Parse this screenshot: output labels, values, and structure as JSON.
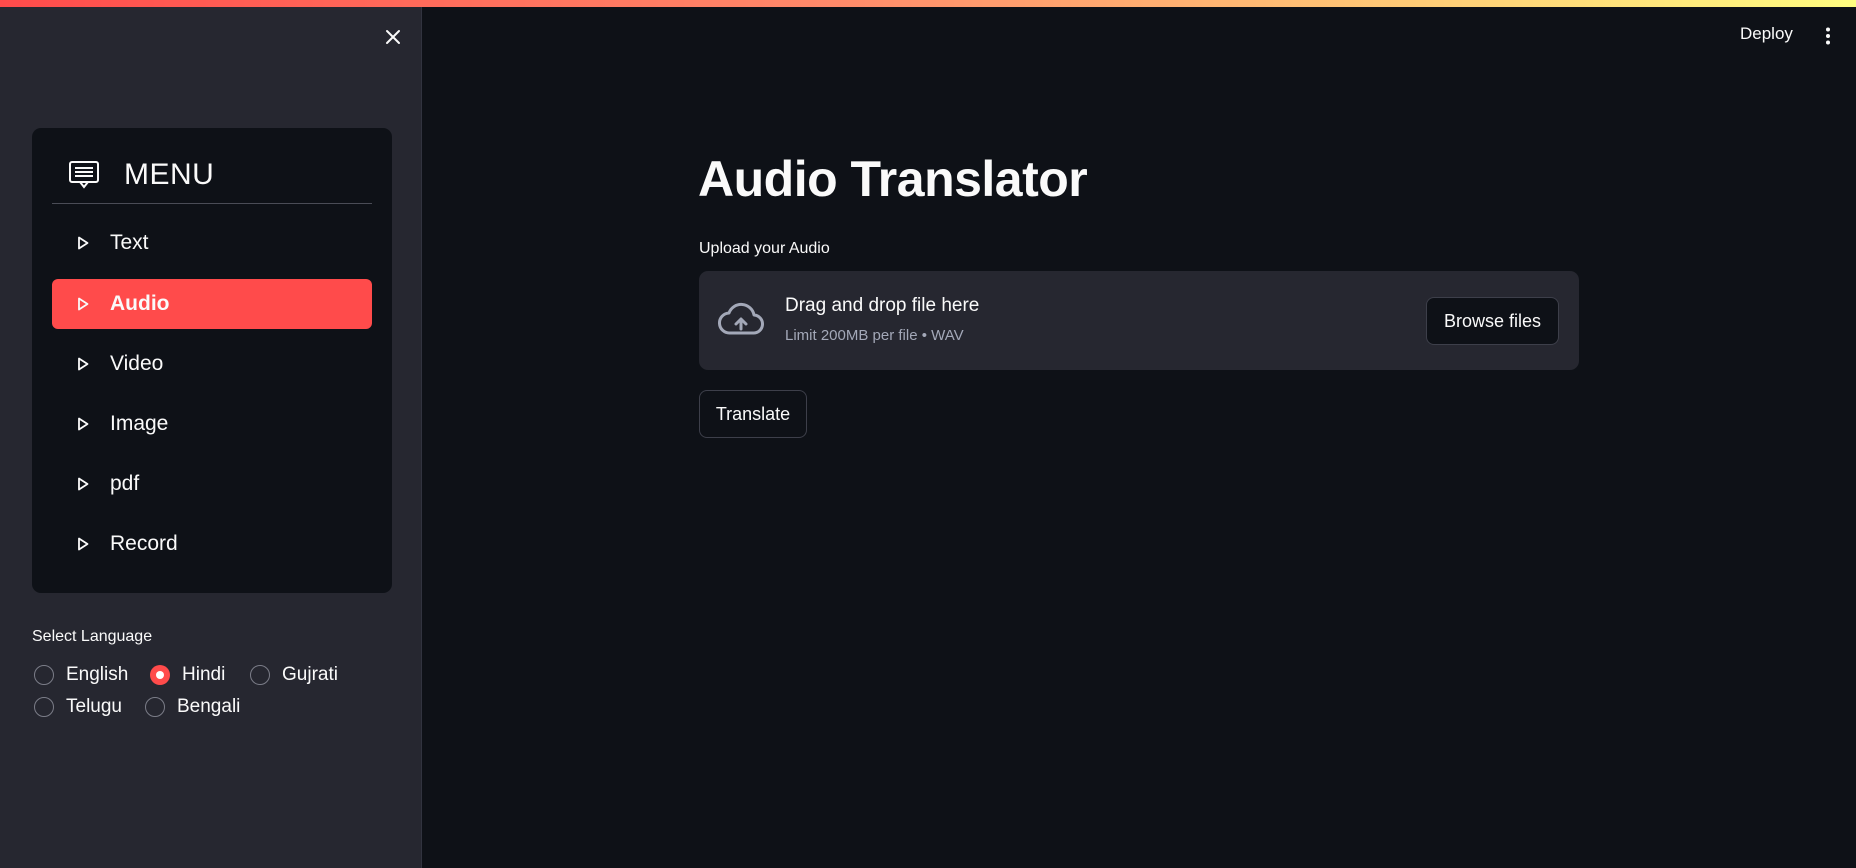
{
  "header": {
    "deploy_label": "Deploy",
    "kebab_icon": "more-vertical-icon"
  },
  "sidebar": {
    "close_icon": "close-icon",
    "menu": {
      "title": "MENU",
      "icon": "menu-list-icon",
      "items": [
        {
          "label": "Text",
          "active": false
        },
        {
          "label": "Audio",
          "active": true
        },
        {
          "label": "Video",
          "active": false
        },
        {
          "label": "Image",
          "active": false
        },
        {
          "label": "pdf",
          "active": false
        },
        {
          "label": "Record",
          "active": false
        }
      ]
    },
    "language": {
      "label": "Select Language",
      "options": [
        "English",
        "Hindi",
        "Gujrati",
        "Telugu",
        "Bengali"
      ],
      "selected": "Hindi"
    }
  },
  "main": {
    "title": "Audio Translator",
    "upload": {
      "label": "Upload your Audio",
      "drop_text": "Drag and drop file here",
      "limit_text": "Limit 200MB per file • WAV",
      "browse_label": "Browse files",
      "icon": "cloud-upload-icon"
    },
    "translate_label": "Translate"
  },
  "colors": {
    "accent": "#ff4b4b",
    "background": "#0e1117",
    "sidebar": "#262730",
    "text": "#fafafa"
  }
}
